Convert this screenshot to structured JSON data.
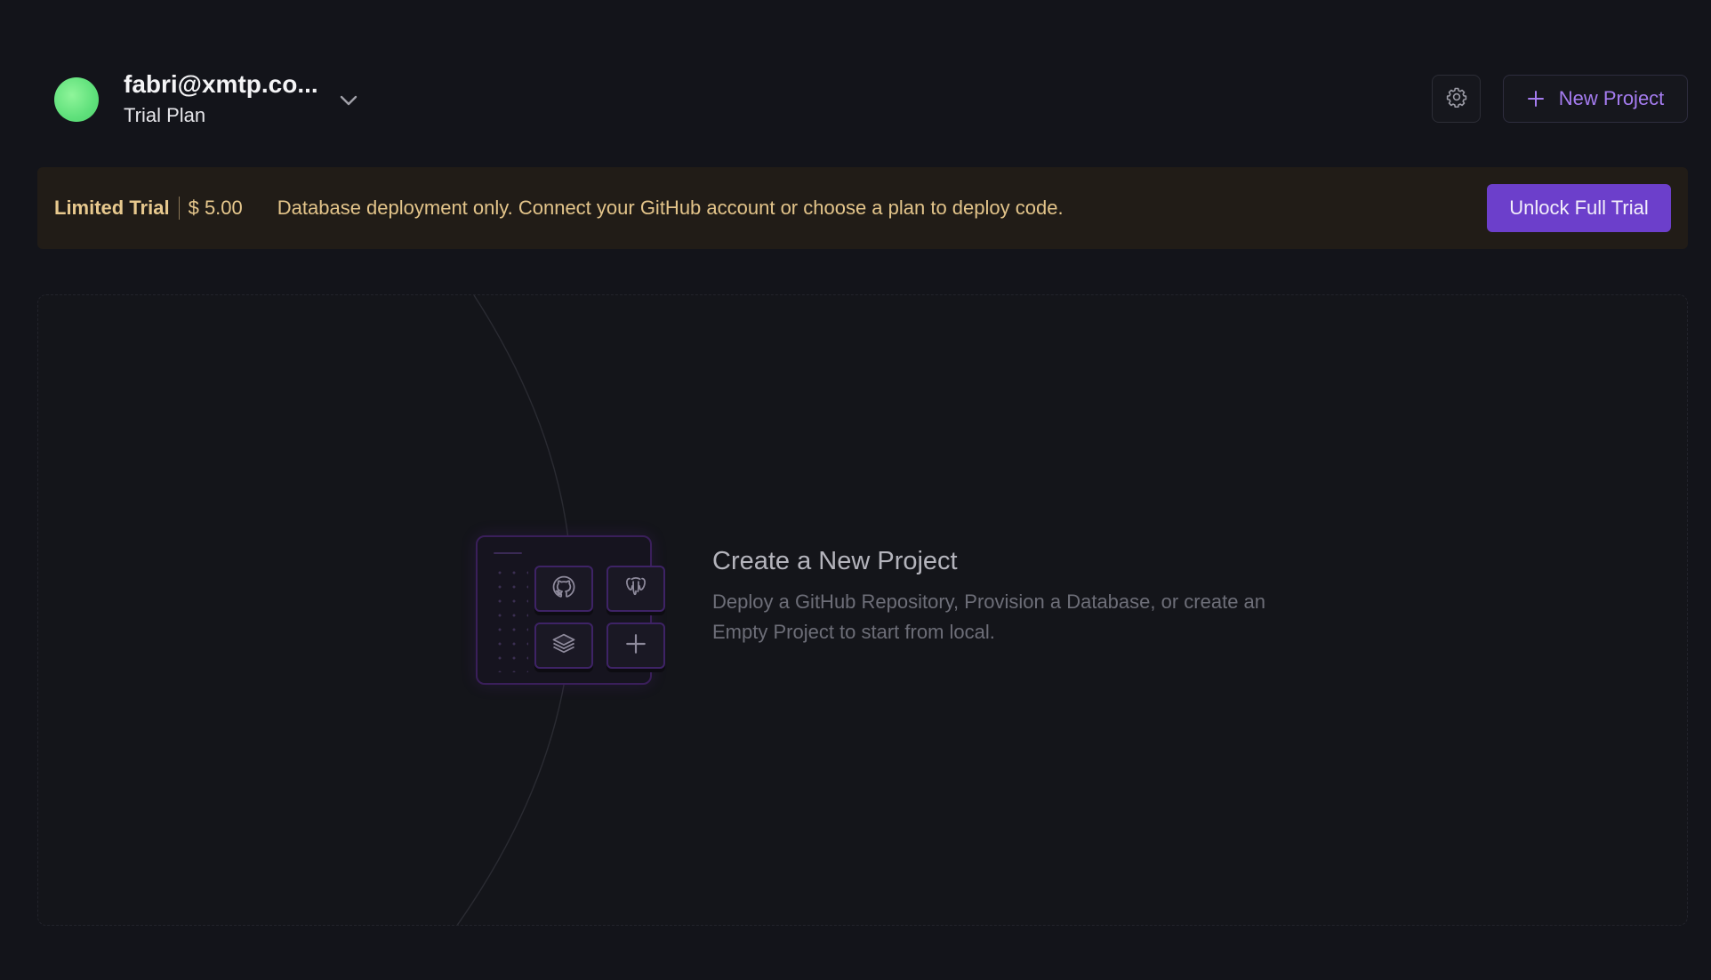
{
  "account": {
    "email": "fabri@xmtp.co...",
    "plan": "Trial Plan",
    "avatar_color": "#6ee87f"
  },
  "header": {
    "settings_icon": "gear-icon",
    "new_project_label": "New Project"
  },
  "banner": {
    "title": "Limited Trial",
    "amount": "$ 5.00",
    "message": "Database deployment only. Connect your GitHub account or choose a plan to deploy code.",
    "unlock_label": "Unlock Full Trial"
  },
  "empty_state": {
    "title": "Create a New Project",
    "description": "Deploy a GitHub Repository, Provision a Database, or create an Empty Project to start from local.",
    "tiles": [
      {
        "icon": "github-icon"
      },
      {
        "icon": "postgres-icon"
      },
      {
        "icon": "stack-icon"
      },
      {
        "icon": "plus-icon"
      }
    ]
  },
  "colors": {
    "background": "#13141a",
    "accent": "#6c3fcb",
    "accent_text": "#a57cf0",
    "banner_bg": "#211c17",
    "banner_text": "#e8c98e"
  }
}
